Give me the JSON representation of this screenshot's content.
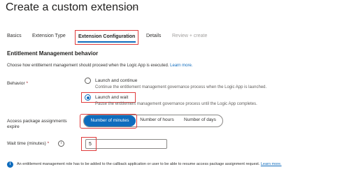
{
  "page": {
    "title": "Create a custom extension",
    "more_icon": "ellipsis-icon"
  },
  "tabs": [
    {
      "label": "Basics",
      "selected": false,
      "disabled": false
    },
    {
      "label": "Extension Type",
      "selected": false,
      "disabled": false
    },
    {
      "label": "Extension Configuration",
      "selected": true,
      "disabled": false
    },
    {
      "label": "Details",
      "selected": false,
      "disabled": false
    },
    {
      "label": "Review + create",
      "selected": false,
      "disabled": true
    }
  ],
  "section": {
    "heading": "Entitlement Management behavior",
    "description": "Choose how entitlement management should proceed when the Logic App is executed.",
    "learn_more": "Learn more."
  },
  "behavior": {
    "label": "Behavior",
    "required_marker": "*",
    "options": [
      {
        "label": "Launch and continue",
        "description": "Continue the entitlement management governance process when the Logic App is launched.",
        "checked": false
      },
      {
        "label": "Launch and wait",
        "description": "Pause the entitlement management governance process until the Logic App completes.",
        "checked": true
      }
    ]
  },
  "expire": {
    "label_line1": "Access package assignments",
    "label_line2": "expire",
    "options": [
      "Number of minutes",
      "Number of hours",
      "Number of days"
    ],
    "selected": "Number of minutes"
  },
  "wait_time": {
    "label": "Wait time (minutes)",
    "required_marker": "*",
    "info_icon": "i",
    "value": "5"
  },
  "footer": {
    "info_glyph": "i",
    "text": "An entitlement management role has to be added to the callback application or user to be able to resume access package assignment request.",
    "link": "Learn more."
  },
  "colors": {
    "accent": "#0f6cbd",
    "highlight_frame": "#e03c3c",
    "required": "#a4262c"
  }
}
